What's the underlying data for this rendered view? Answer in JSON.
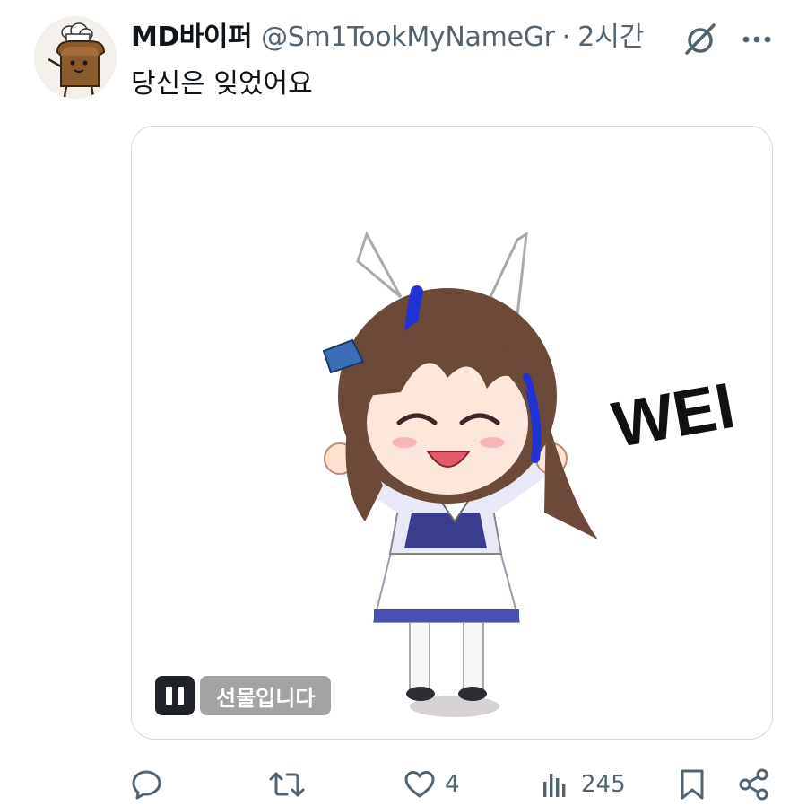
{
  "tweet": {
    "display_name": "MD바이퍼",
    "handle": "@Sm1TookMyNameGr",
    "separator": "·",
    "time": "2시간",
    "text": "당신은 잊었어요"
  },
  "media": {
    "overlay_text": "WEI",
    "gif_label": "선물입니다",
    "pause_icon": "pause-icon"
  },
  "actions": {
    "reply": {
      "icon": "reply-icon",
      "count": ""
    },
    "retweet": {
      "icon": "retweet-icon",
      "count": ""
    },
    "like": {
      "icon": "heart-icon",
      "count": "4"
    },
    "views": {
      "icon": "views-icon",
      "count": "245"
    },
    "bookmark": {
      "icon": "bookmark-icon"
    },
    "share": {
      "icon": "share-icon"
    }
  },
  "colors": {
    "text": "#0f1419",
    "secondary": "#536471",
    "border": "#cfd9de",
    "hair_blue": "#2233d6",
    "dress_navy": "#3d3f8f"
  }
}
